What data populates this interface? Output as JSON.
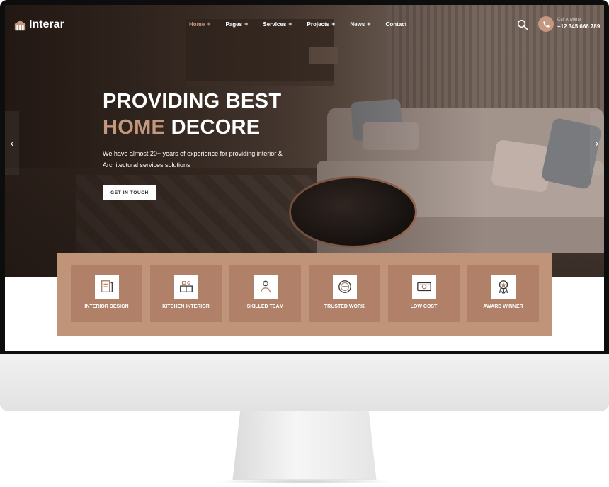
{
  "brand": {
    "name": "Interar",
    "accent": "#c4987e"
  },
  "nav": {
    "items": [
      {
        "label": "Home",
        "plus": "+",
        "active": true
      },
      {
        "label": "Pages",
        "plus": "+"
      },
      {
        "label": "Services",
        "plus": "+"
      },
      {
        "label": "Projects",
        "plus": "+"
      },
      {
        "label": "News",
        "plus": "+"
      },
      {
        "label": "Contact",
        "plus": ""
      }
    ],
    "search_icon": "search-icon"
  },
  "call": {
    "label": "Call Anytime",
    "number": "+12 345 666 789"
  },
  "hero": {
    "title_line1": "PROVIDING BEST",
    "title_accent": "HOME",
    "title_rest": "DECORE",
    "lead": "We have almost 20+ years of experience for providing interior & Architectural services solutions",
    "cta": "GET IN TOUCH",
    "prev": "‹",
    "next": "›"
  },
  "features": [
    {
      "label": "INTERIOR DESIGN",
      "icon": "interior-design-icon"
    },
    {
      "label": "KITCHEN INTERIOR",
      "icon": "kitchen-icon"
    },
    {
      "label": "SKILLED TEAM",
      "icon": "team-icon"
    },
    {
      "label": "TRUSTED WORK",
      "icon": "badge-icon"
    },
    {
      "label": "LOW COST",
      "icon": "money-icon"
    },
    {
      "label": "AWARD WINNER",
      "icon": "award-icon"
    }
  ]
}
